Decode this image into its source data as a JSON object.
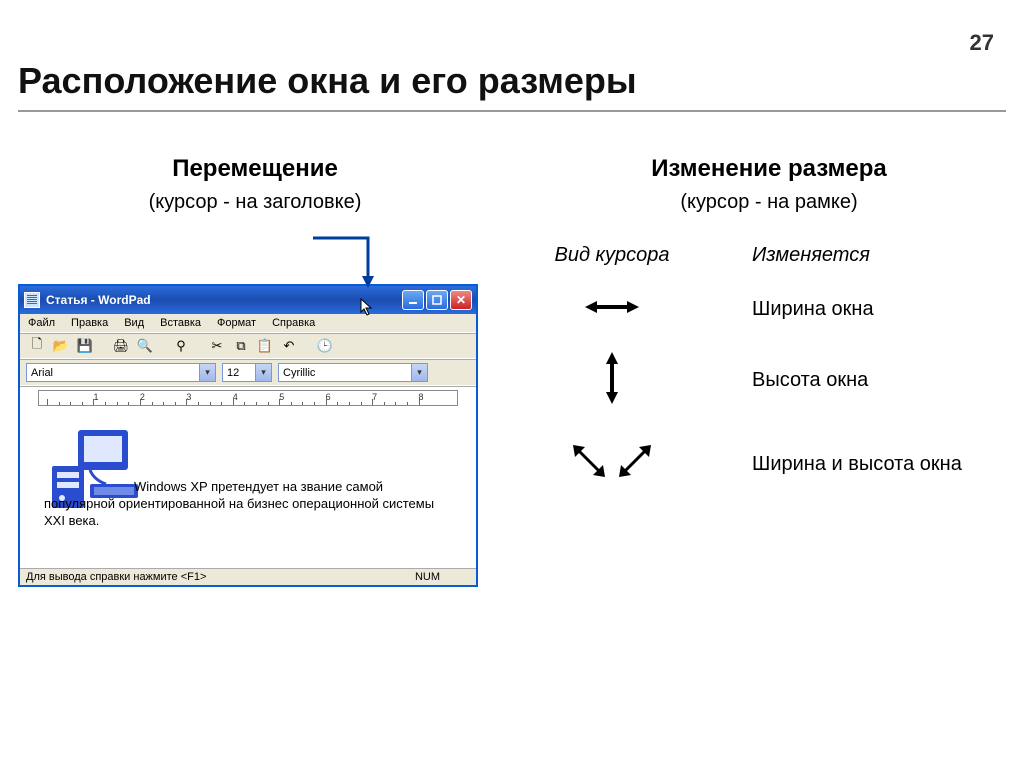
{
  "page_number": "27",
  "title": "Расположение окна и его размеры",
  "left": {
    "heading": "Перемещение",
    "sub": "(курсор - на заголовке)"
  },
  "right": {
    "heading": "Изменение размера",
    "sub": "(курсор - на рамке)",
    "header_cursor": "Вид курсора",
    "header_changes": "Изменяется",
    "rows": [
      {
        "label": "Ширина окна"
      },
      {
        "label": "Высота окна"
      },
      {
        "label": "Ширина и высота окна"
      }
    ]
  },
  "wordpad": {
    "title": "Статья - WordPad",
    "menu": [
      "Файл",
      "Правка",
      "Вид",
      "Вставка",
      "Формат",
      "Справка"
    ],
    "font": "Arial",
    "size": "12",
    "charset": "Cyrillic",
    "doc_text": "Windows XP претендует на звание самой популярной ориентированной на бизнес операционной системы XXI века.",
    "status_left": "Для вывода справки нажмите <F1>",
    "status_right": "NUM",
    "ruler_marks": [
      "1",
      "2",
      "3",
      "4",
      "5",
      "6",
      "7",
      "8"
    ]
  }
}
